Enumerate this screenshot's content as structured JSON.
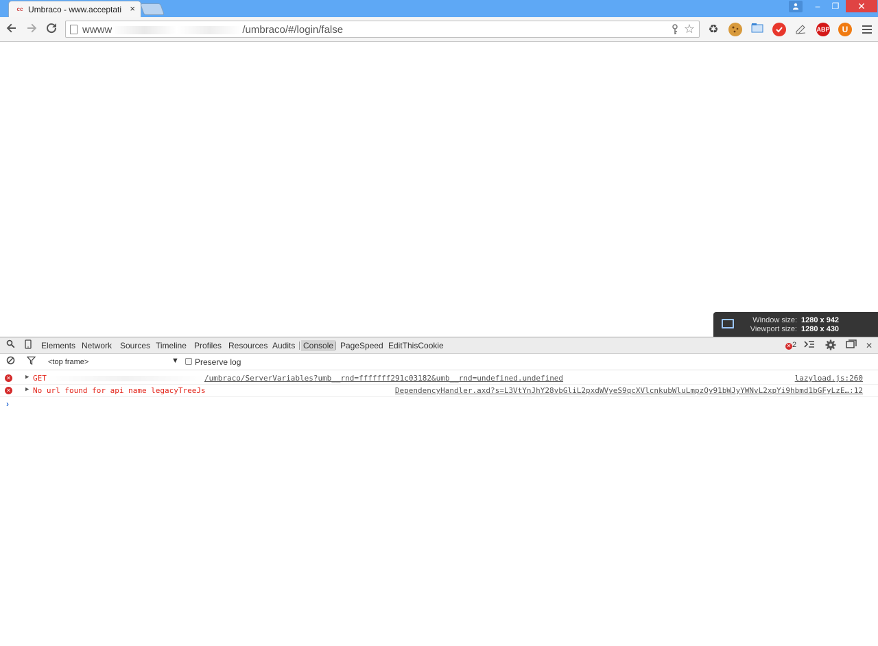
{
  "browser": {
    "tab_title": "Umbraco - www.acceptati",
    "tab_close": "×",
    "window_buttons": {
      "min": "–",
      "max": "❐",
      "close": "✕"
    },
    "url_prefix": "wwww",
    "url_suffix": "/umbraco/#/login/false",
    "extensions": [
      {
        "name": "recycle-icon",
        "color": "#4a4a4a",
        "label": "♻"
      },
      {
        "name": "cookie-icon",
        "color": "#d89a3c",
        "label": ""
      },
      {
        "name": "folder-icon",
        "color": "#3a86d6",
        "label": ""
      },
      {
        "name": "lastpass-icon",
        "color": "#e8372c",
        "label": ""
      },
      {
        "name": "pen-icon",
        "color": "#666666",
        "label": ""
      },
      {
        "name": "abp-icon",
        "color": "#d41818",
        "label": "ABP"
      },
      {
        "name": "ublock-icon",
        "color": "#f07b12",
        "label": "U"
      }
    ]
  },
  "overlay": {
    "window_label": "Window size:",
    "window_value": "1280 x 942",
    "viewport_label": "Viewport size:",
    "viewport_value": "1280 x 430"
  },
  "devtools": {
    "tabs": [
      "Elements",
      "Network",
      "Sources",
      "Timeline",
      "Profiles",
      "Resources",
      "Audits",
      "Console",
      "PageSpeed",
      "EditThisCookie"
    ],
    "active_tab": "Console",
    "error_count": "2",
    "frame_select": "<top frame>",
    "preserve_log": "Preserve log",
    "logs": [
      {
        "message_prefix": "GET",
        "message": "/umbraco/ServerVariables?umb__rnd=fffffff291c03182&umb__rnd=undefined.undefined",
        "source": "lazyload.js:260"
      },
      {
        "message_prefix": "",
        "message": "No url found for api name legacyTreeJs",
        "source": "DependencyHandler.axd?s=L3VtYnJhY28vbGliL2pxdWVyeS9qcXVlcnkubWluLmpzOy91bWJyYWNvL2xpYi9hbmd1bGFyLzE…:12"
      }
    ],
    "prompt": "›"
  }
}
